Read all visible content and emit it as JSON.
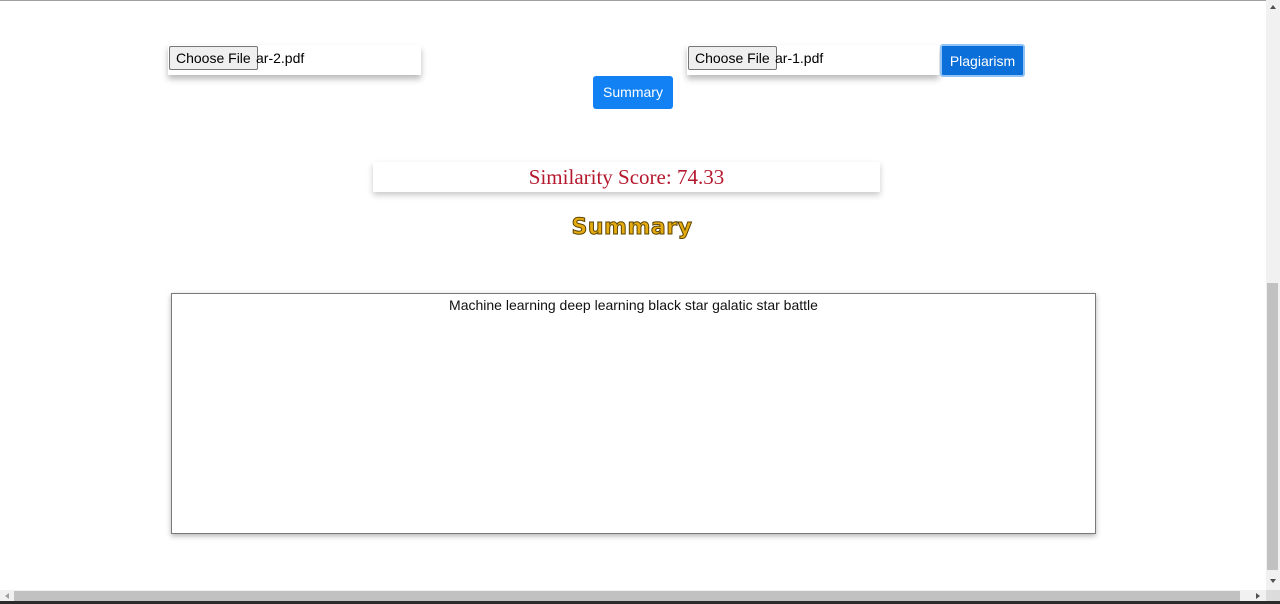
{
  "upload_left": {
    "choose_label": "Choose File",
    "file_name": "ar-2.pdf"
  },
  "upload_right": {
    "choose_label": "Choose File",
    "file_name": "ar-1.pdf"
  },
  "buttons": {
    "plagiarism_label": "Plagiarism",
    "summary_label": "Summary"
  },
  "score": {
    "text": "Similarity Score: 74.33"
  },
  "summary": {
    "heading": "Summary",
    "text": "Machine learning deep learning black star galatic star battle"
  },
  "colors": {
    "button_blue": "#1181f4",
    "score_red": "#b5192e",
    "heading_gold": "#e6ab10"
  },
  "icons": {
    "scroll_up": "triangle-up",
    "scroll_down": "triangle-down",
    "scroll_left": "triangle-left",
    "scroll_right": "triangle-right"
  }
}
